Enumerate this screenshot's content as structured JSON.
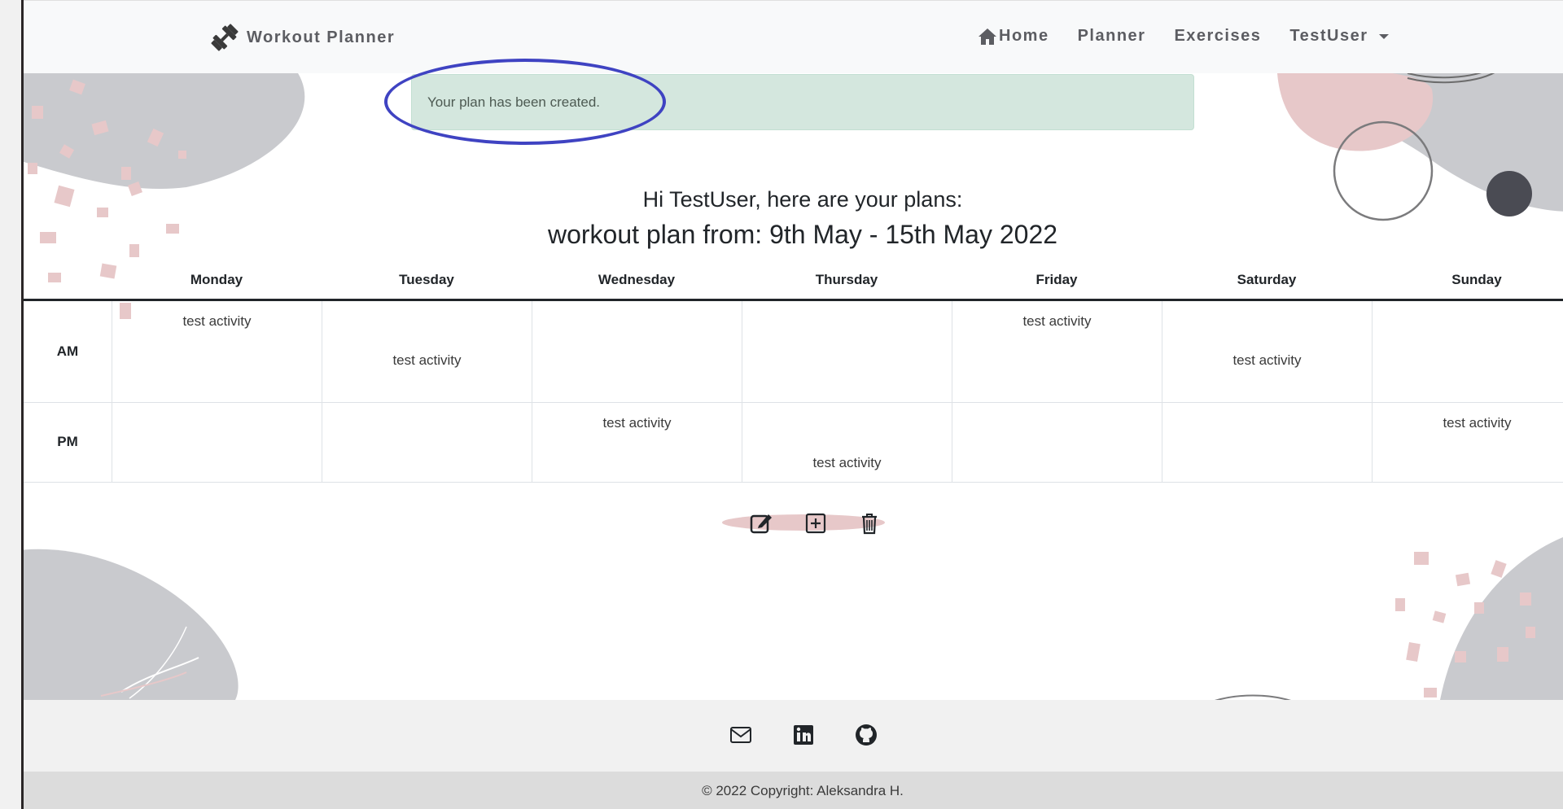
{
  "navbar": {
    "brand": "Workout Planner",
    "links": [
      "Home",
      "Planner",
      "Exercises"
    ],
    "user_menu": "TestUser"
  },
  "alert": {
    "message": "Your plan has been created."
  },
  "heading": {
    "greeting": "Hi TestUser, here are your plans:",
    "plan_range": "workout plan from: 9th May - 15th May 2022"
  },
  "planner": {
    "days": [
      "Monday",
      "Tuesday",
      "Wednesday",
      "Thursday",
      "Friday",
      "Saturday",
      "Sunday"
    ],
    "rows": [
      {
        "label": "AM",
        "cells": [
          "test activity",
          "test activity",
          "",
          "",
          "test activity",
          "test activity",
          ""
        ]
      },
      {
        "label": "PM",
        "cells": [
          "",
          "",
          "test activity",
          "test activity",
          "",
          "",
          "test activity"
        ]
      }
    ]
  },
  "actions": {
    "icons": [
      "edit-icon",
      "add-icon",
      "delete-icon"
    ]
  },
  "footer": {
    "icons": [
      "email-icon",
      "linkedin-icon",
      "github-icon"
    ],
    "copyright": "© 2022 Copyright: Aleksandra H."
  },
  "colors": {
    "alert_bg": "#d4e7de",
    "annotation_ring": "#3f43c2",
    "nav_text": "#5c5d62",
    "blob_gray": "#c9cace",
    "blob_pink": "#e7c8c9"
  }
}
